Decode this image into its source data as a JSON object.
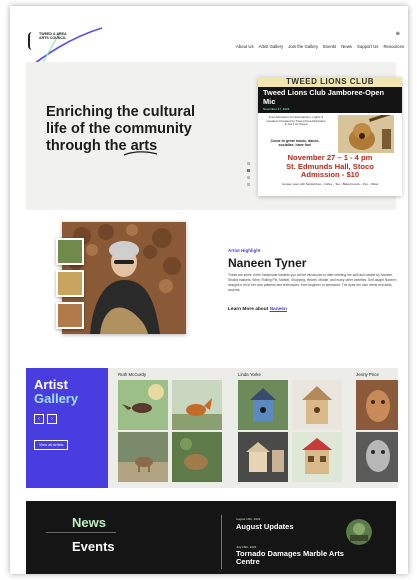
{
  "header": {
    "logo_text": "TWEED & AREA ARTS COUNCIL",
    "nav": [
      "About Us",
      "Artist Gallery",
      "Join the Gallery",
      "Events",
      "News",
      "Support Us",
      "Resources"
    ]
  },
  "hero": {
    "headline_part1": "Enriching the cultural life of the community through the ",
    "headline_accent": "arts",
    "poster": {
      "banner": "TWEED LIONS CLUB",
      "title": "Tweed Lions Club Jamboree-Open Mic",
      "date_small": "November 17, 2023",
      "blurb": "Free Admission for Entertainers. Lights & speakers Donated by Tweed Area Musicians & Joe's At Tweed",
      "invite": "Come to great music, dance, socialize, have fun!",
      "event_date": "November 27 – 1 - 4 pm",
      "venue": "St. Edmunds Hall, Stoco",
      "admission": "Admission - $10",
      "footer": "Canteen open with Sandwiches – Coffee – Tea – Baked Goods – Pop – Water"
    }
  },
  "artist_highlight": {
    "label": "Artist Highlight",
    "name": "Naneen Tyner",
    "description": "These are some of the handmade baskets you will be introduced to after meeting the split ash basket by Naneen. Shallot baskets, Wine, Rolling Pin, Market, Shopping, Hearth, Middle, and many other varieties. Self-taught Naneen designs a lot of her own patterns and techniques, from beginner to advanced. The dyes her own reeds and adds accents.",
    "more_prefix": "Learn More about ",
    "more_link": "Naneen"
  },
  "gallery": {
    "title_line1": "Artist",
    "title_line2": "Gallery",
    "prev": "‹",
    "next": "›",
    "view_all": "View all Artists",
    "artists": [
      "Ruth McCurdy",
      "Linda Yorke",
      "Jenny Price"
    ]
  },
  "news": {
    "news_label": "News",
    "events_label": "Events",
    "items": [
      {
        "date": "August 10th, 2023",
        "title": "August Updates"
      },
      {
        "date": "July 26th, 2023",
        "title": "Tornado Damages Marble Arts Centre"
      }
    ]
  },
  "colors": {
    "accent_purple": "#4a3de0",
    "accent_mint": "#b9f0c0",
    "dark": "#151515"
  }
}
